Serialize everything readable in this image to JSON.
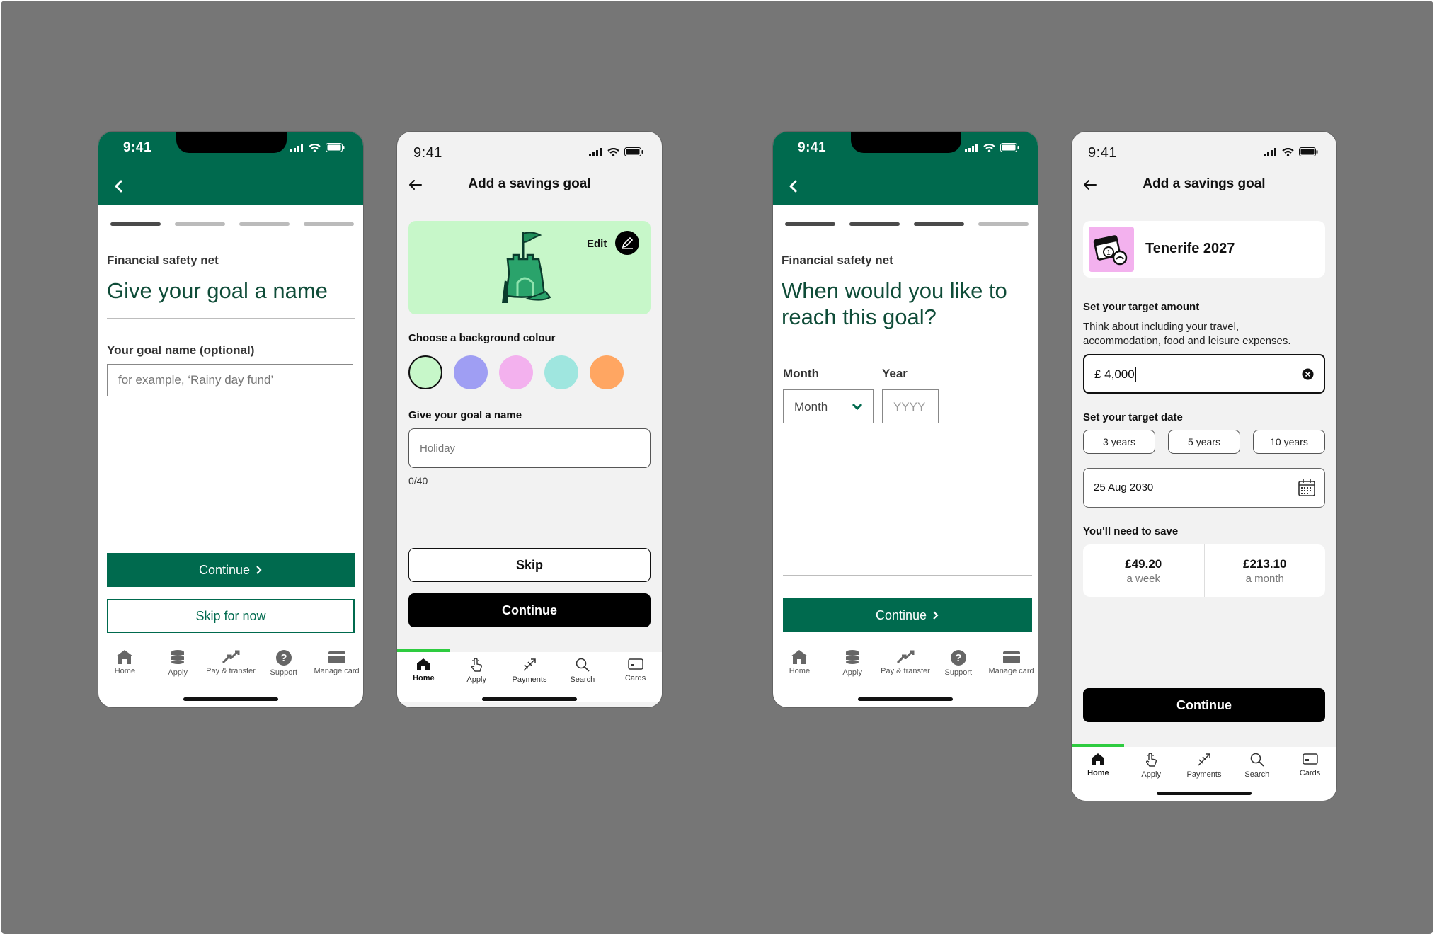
{
  "screens": {
    "s1": {
      "time": "9:41",
      "eyebrow": "Financial safety net",
      "title": "Give your goal a name",
      "field_label": "Your goal name (optional)",
      "placeholder": "for example, ‘Rainy day fund’",
      "continue": "Continue",
      "skip": "Skip for now",
      "progress_step": 1,
      "tabs": [
        "Home",
        "Apply",
        "Pay & transfer",
        "Support",
        "Manage card"
      ]
    },
    "s2": {
      "time": "9:41",
      "title": "Add a savings goal",
      "edit": "Edit",
      "choose_colour": "Choose a background colour",
      "swatches": [
        "#c7f7c9",
        "#9f9ef3",
        "#f3b1ee",
        "#9fe6df",
        "#ffa662"
      ],
      "name_label": "Give your goal a name",
      "name_placeholder": "Holiday",
      "counter": "0/40",
      "skip": "Skip",
      "continue": "Continue",
      "tabs": [
        "Home",
        "Apply",
        "Payments",
        "Search",
        "Cards"
      ]
    },
    "s3": {
      "time": "9:41",
      "eyebrow": "Financial safety net",
      "title": "When would you like to reach this goal?",
      "month_label": "Month",
      "year_label": "Year",
      "month_value": "Month",
      "year_placeholder": "YYYY",
      "continue": "Continue",
      "progress_step": 3,
      "tabs": [
        "Home",
        "Apply",
        "Pay & transfer",
        "Support",
        "Manage card"
      ]
    },
    "s4": {
      "time": "9:41",
      "title": "Add a savings goal",
      "goal_name": "Tenerife 2027",
      "target_label": "Set your target amount",
      "target_hint": "Think about including your travel, accommodation, food and leisure expenses.",
      "amount": "£ 4,000",
      "date_label": "Set your target date",
      "chips": [
        "3 years",
        "5 years",
        "10 years"
      ],
      "date_value": "25 Aug 2030",
      "need_label": "You'll need to save",
      "weekly_amount": "£49.20",
      "weekly_unit": "a week",
      "monthly_amount": "£213.10",
      "monthly_unit": "a month",
      "continue": "Continue",
      "tabs": [
        "Home",
        "Apply",
        "Payments",
        "Search",
        "Cards"
      ]
    }
  },
  "colors": {
    "brand_green": "#006a4e",
    "heading_green": "#0f4c38",
    "active_tab_bar": "#2ecc40",
    "illustration_bg": "#c7f7c9",
    "goal_icon_bg": "#f3b1ee"
  }
}
